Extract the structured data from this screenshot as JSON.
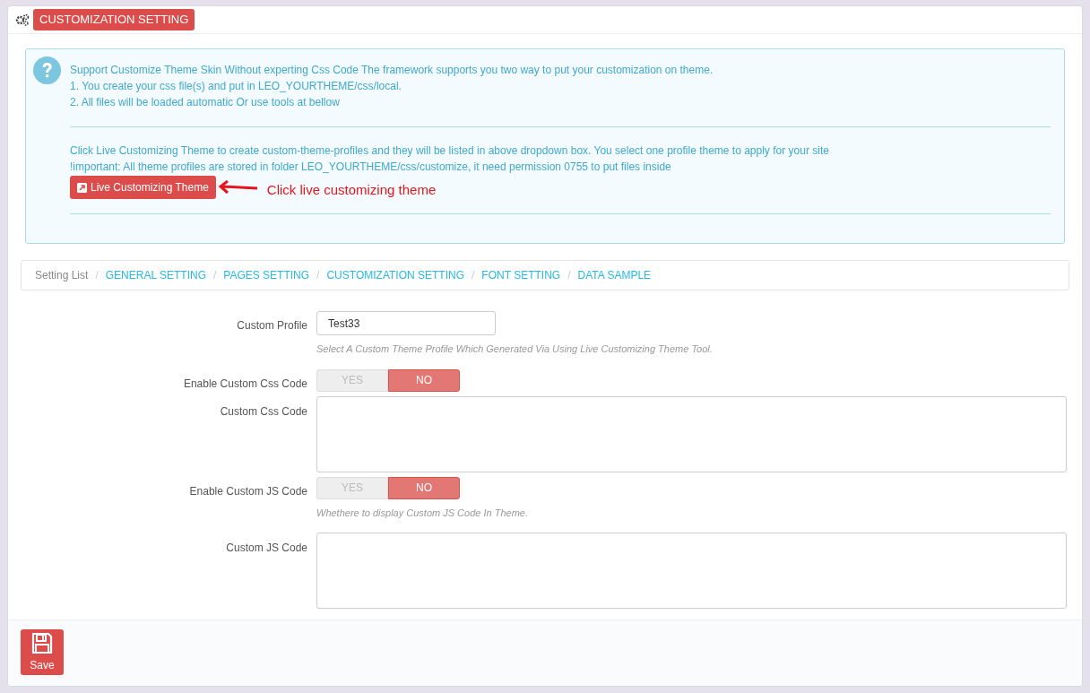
{
  "panel": {
    "title": "CUSTOMIZATION SETTING"
  },
  "info": {
    "lines": [
      "Support Customize Theme Skin Without experting Css Code The framework supports you two way to put your customization on theme.",
      "1. You create your css file(s) and put in LEO_YOURTHEME/css/local.",
      "2. All files will be loaded automatic Or use tools at bellow"
    ],
    "lines_2": [
      "Click Live Customizing Theme to create custom-theme-profiles and they will be listed in above dropdown box. You select one profile theme to apply for your site",
      "!important: All theme profiles are stored in folder LEO_YOURTHEME/css/customize, it need permission 0755 to put files inside"
    ],
    "button": "Live Customizing Theme",
    "annotation": "Click live customizing theme"
  },
  "breadcrumb": [
    {
      "label": "Setting List",
      "link": false
    },
    {
      "separator": "/",
      "label": "GENERAL SETTING",
      "link": true
    },
    {
      "separator": "/",
      "label": "PAGES SETTING",
      "link": true
    },
    {
      "separator": "/",
      "label": "CUSTOMIZATION SETTING",
      "link": true
    },
    {
      "separator": "/",
      "label": "FONT SETTING",
      "link": true
    },
    {
      "separator": "/",
      "label": "DATA SAMPLE",
      "link": true
    }
  ],
  "fields": [
    {
      "kind": "text",
      "label": "Custom Profile",
      "value": "Test33",
      "help": "Select A Custom Theme Profile Which Generated Via Using Live Customizing Theme Tool."
    },
    {
      "kind": "switch",
      "label": "Enable Custom Css Code",
      "options": [
        {
          "label": "YES",
          "selected": false
        },
        {
          "label": "NO",
          "selected": true
        }
      ]
    },
    {
      "kind": "textarea",
      "label": "Custom Css Code"
    },
    {
      "kind": "switch",
      "label": "Enable Custom JS Code",
      "options": [
        {
          "label": "YES",
          "selected": false
        },
        {
          "label": "NO",
          "selected": true
        }
      ],
      "help": "Whethere to display Custom JS Code In Theme."
    },
    {
      "kind": "textarea",
      "label": "Custom JS Code"
    }
  ],
  "save_button": "Save"
}
